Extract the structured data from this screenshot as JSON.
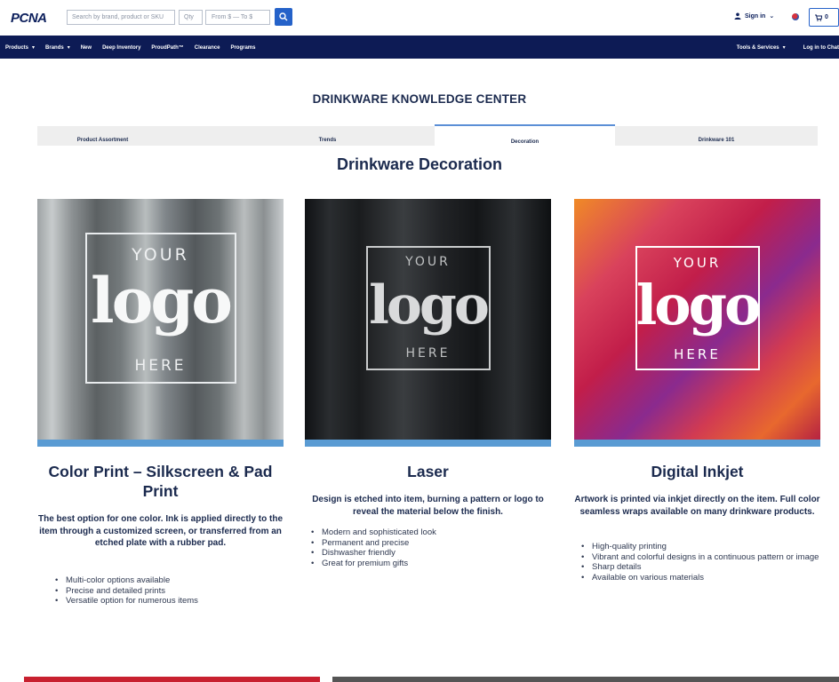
{
  "header": {
    "logo": "PCNA",
    "search_placeholder": "Search by brand, product or SKU",
    "qty_placeholder": "Qty",
    "price_placeholder": "From $ — To $",
    "signin_label": "Sign in",
    "cart_count": "0"
  },
  "nav": {
    "left": [
      "Products",
      "Brands",
      "New",
      "Deep Inventory",
      "ProudPath™",
      "Clearance",
      "Programs"
    ],
    "right": [
      "Tools & Services",
      "Log in to Chat"
    ]
  },
  "page": {
    "kc_title": "DRINKWARE KNOWLEDGE CENTER",
    "tabs": [
      "Product Assortment",
      "Trends",
      "Decoration",
      "Drinkware 101"
    ],
    "active_tab": "Decoration",
    "section_title": "Drinkware Decoration"
  },
  "logo_art": {
    "top": "YOUR",
    "middle": "logo",
    "bottom": "HERE"
  },
  "cards": [
    {
      "title": "Color Print – Silkscreen & Pad Print",
      "description": "The best option for one color. Ink is applied directly to the item through a customized screen, or transferred from an etched plate with a rubber pad.",
      "bullets": [
        "Multi-color options available",
        "Precise and detailed prints",
        "Versatile option for numerous items"
      ]
    },
    {
      "title": "Laser",
      "description": "Design is etched into item, burning a pattern or logo to reveal the material below the finish.",
      "bullets": [
        "Modern and sophisticated look",
        "Permanent and precise",
        "Dishwasher friendly",
        "Great for premium gifts"
      ]
    },
    {
      "title": "Digital Inkjet",
      "description": "Artwork is printed via inkjet directly on the item. Full color seamless wraps available on many drinkware products.",
      "bullets": [
        "High-quality printing",
        "Vibrant and colorful designs in a continuous pattern or image",
        "Sharp details",
        "Available on various materials"
      ]
    }
  ],
  "colors": {
    "navy": "#0d1b55",
    "accent_blue": "#2562c9",
    "stripe_blue": "#5a9bd3",
    "footer_red": "#c8202f"
  }
}
